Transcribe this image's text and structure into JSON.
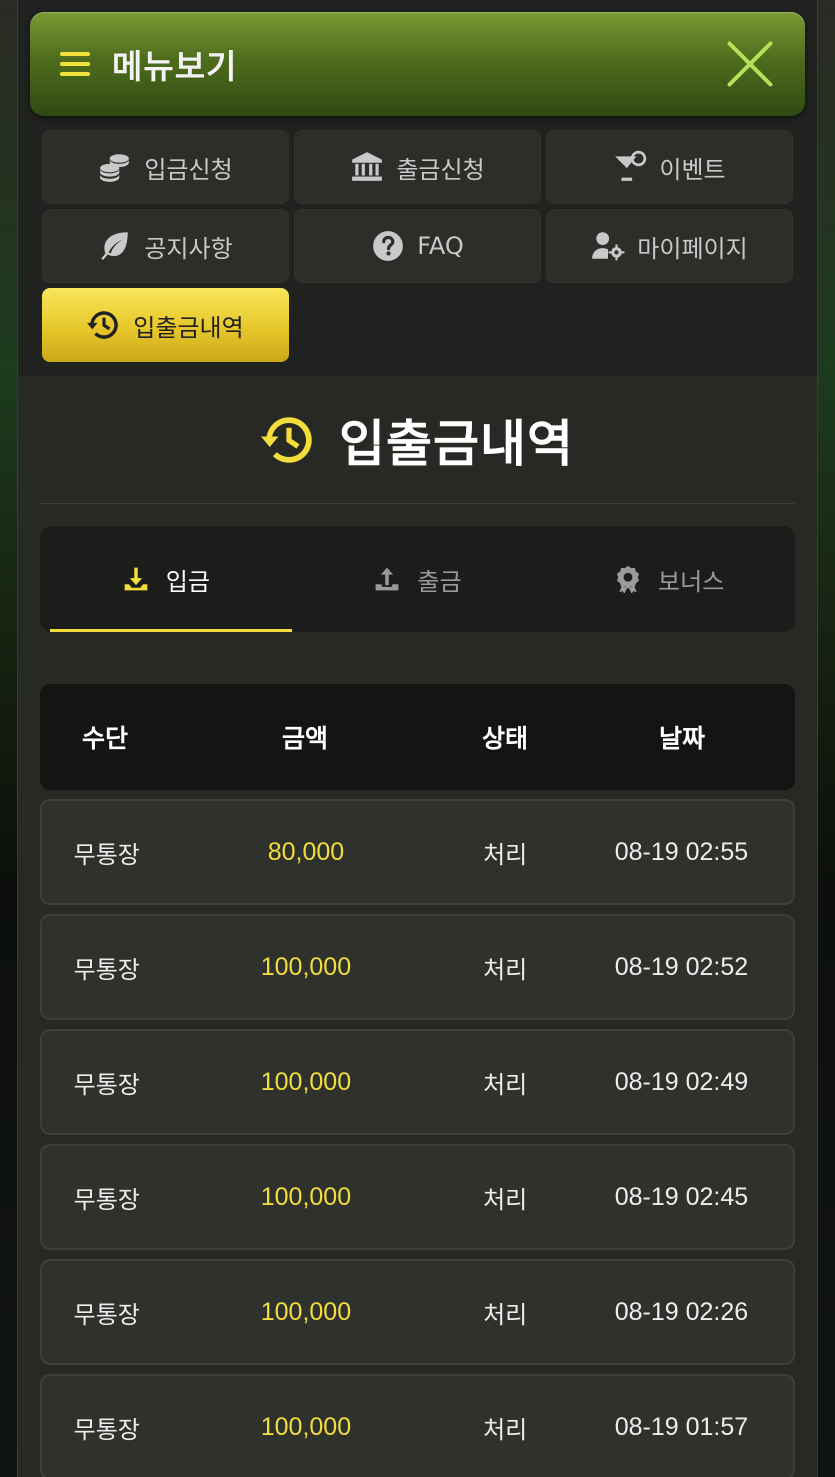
{
  "menu": {
    "title": "메뉴보기",
    "items": [
      {
        "label": "입금신청",
        "icon": "coins-icon"
      },
      {
        "label": "출금신청",
        "icon": "bank-icon"
      },
      {
        "label": "이벤트",
        "icon": "cocktail-icon"
      },
      {
        "label": "공지사항",
        "icon": "leaf-icon"
      },
      {
        "label": "FAQ",
        "icon": "question-circle-icon"
      },
      {
        "label": "마이페이지",
        "icon": "user-gear-icon"
      },
      {
        "label": "입출금내역",
        "icon": "history-icon",
        "active": true
      }
    ]
  },
  "page": {
    "title": "입출금내역"
  },
  "tabs": [
    {
      "label": "입금",
      "icon": "download-icon",
      "active": true
    },
    {
      "label": "출금",
      "icon": "upload-icon"
    },
    {
      "label": "보너스",
      "icon": "award-icon"
    }
  ],
  "table": {
    "headers": {
      "method": "수단",
      "amount": "금액",
      "status": "상태",
      "date": "날짜"
    },
    "rows": [
      {
        "method": "무통장",
        "amount": "80,000",
        "status": "처리",
        "date": "08-19 02:55"
      },
      {
        "method": "무통장",
        "amount": "100,000",
        "status": "처리",
        "date": "08-19 02:52"
      },
      {
        "method": "무통장",
        "amount": "100,000",
        "status": "처리",
        "date": "08-19 02:49"
      },
      {
        "method": "무통장",
        "amount": "100,000",
        "status": "처리",
        "date": "08-19 02:45"
      },
      {
        "method": "무통장",
        "amount": "100,000",
        "status": "처리",
        "date": "08-19 02:26"
      },
      {
        "method": "무통장",
        "amount": "100,000",
        "status": "처리",
        "date": "08-19 01:57"
      }
    ]
  },
  "colors": {
    "accent_yellow": "#f4dc3a",
    "header_green": "#4f6d1d",
    "close_green": "#b4e05a",
    "panel_bg": "#262924"
  }
}
